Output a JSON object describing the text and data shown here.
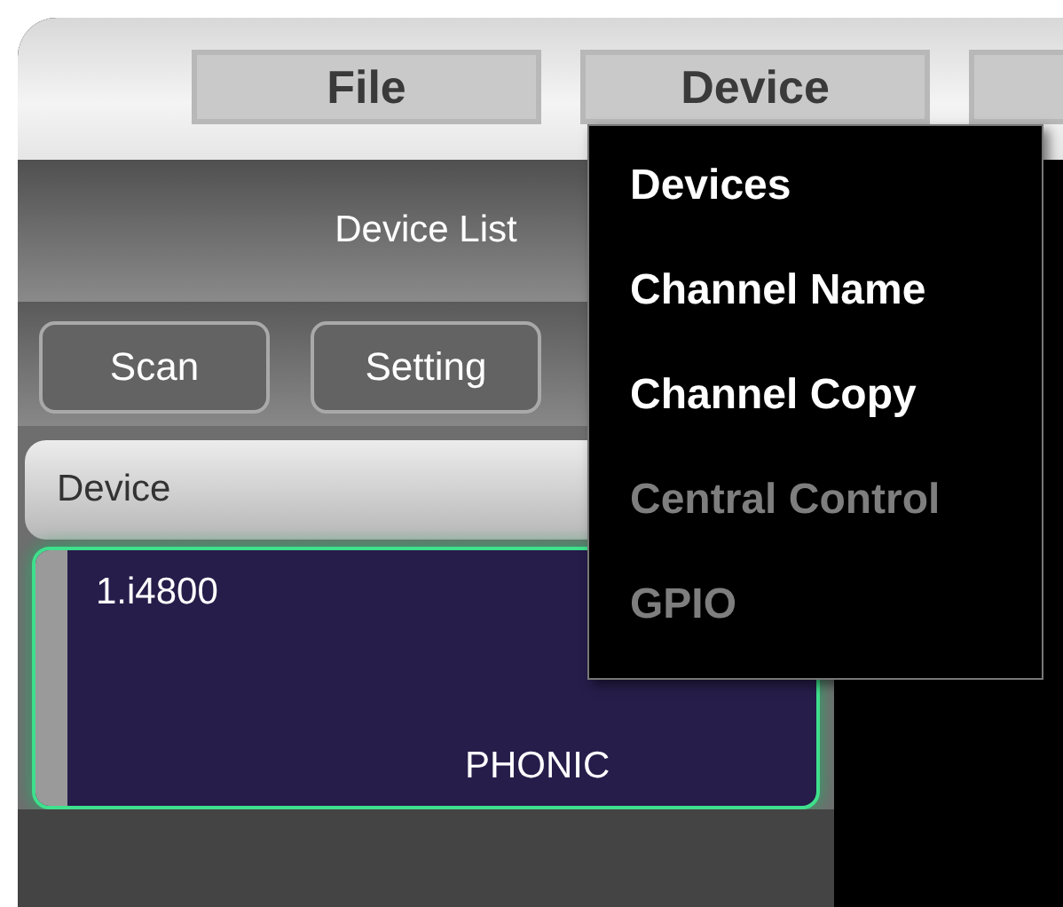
{
  "menu_bar": {
    "items": [
      {
        "label": "File"
      },
      {
        "label": "Device"
      }
    ]
  },
  "panel": {
    "title": "Device List",
    "buttons": [
      "Scan",
      "Setting"
    ]
  },
  "device_table": {
    "columns": [
      "Device"
    ],
    "rows": [
      {
        "name": "1.i4800",
        "brand": "PHONIC",
        "selected": true
      }
    ]
  },
  "dropdown_menu": {
    "items": [
      {
        "label": "Devices",
        "disabled": false
      },
      {
        "label": "Channel Name",
        "disabled": false
      },
      {
        "label": "Channel Copy",
        "disabled": false
      },
      {
        "label": "Central Control",
        "disabled": true
      },
      {
        "label": "GPIO",
        "disabled": true
      }
    ]
  }
}
